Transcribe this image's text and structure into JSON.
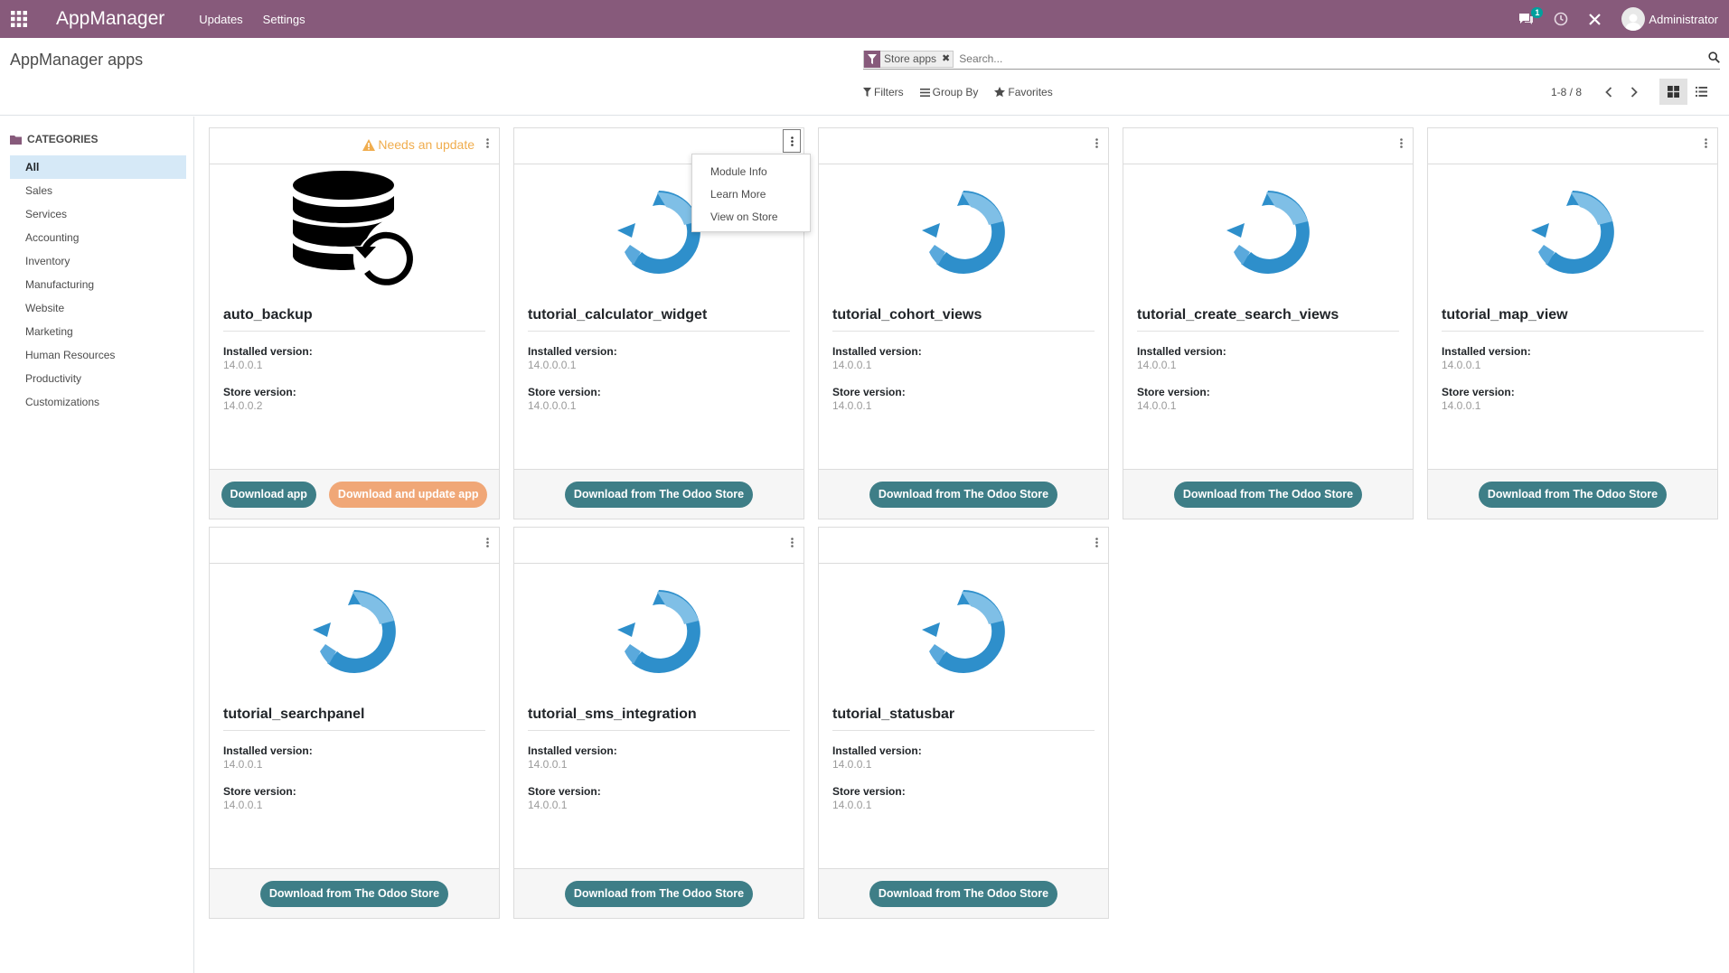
{
  "navbar": {
    "brand": "AppManager",
    "menu": [
      "Updates",
      "Settings"
    ],
    "messaging_badge": "1",
    "user": "Administrator"
  },
  "page": {
    "title": "AppManager apps"
  },
  "search": {
    "facet_label": "Store apps",
    "placeholder": "Search..."
  },
  "options": {
    "filters": "Filters",
    "group_by": "Group By",
    "favorites": "Favorites"
  },
  "pager": {
    "value": "1-8 / 8"
  },
  "sidebar": {
    "header": "CATEGORIES",
    "items": [
      "All",
      "Sales",
      "Services",
      "Accounting",
      "Inventory",
      "Manufacturing",
      "Website",
      "Marketing",
      "Human Resources",
      "Productivity",
      "Customizations"
    ],
    "active": "All"
  },
  "labels": {
    "installed_version": "Installed version:",
    "store_version": "Store version:",
    "needs_update": "Needs an update",
    "download_store": "Download from The Odoo Store",
    "download_app": "Download app",
    "download_update": "Download and update app"
  },
  "dropdown": {
    "items": [
      "Module Info",
      "Learn More",
      "View on Store"
    ]
  },
  "apps": [
    {
      "name": "auto_backup",
      "installed": "14.0.0.1",
      "store": "14.0.0.2",
      "needs_update": true,
      "icon": "database-restore-icon"
    },
    {
      "name": "tutorial_calculator_widget",
      "installed": "14.0.0.0.1",
      "store": "14.0.0.0.1",
      "needs_update": false,
      "icon": "odoo-logo-icon"
    },
    {
      "name": "tutorial_cohort_views",
      "installed": "14.0.0.1",
      "store": "14.0.0.1",
      "needs_update": false,
      "icon": "odoo-logo-icon"
    },
    {
      "name": "tutorial_create_search_views",
      "installed": "14.0.0.1",
      "store": "14.0.0.1",
      "needs_update": false,
      "icon": "odoo-logo-icon"
    },
    {
      "name": "tutorial_map_view",
      "installed": "14.0.0.1",
      "store": "14.0.0.1",
      "needs_update": false,
      "icon": "odoo-logo-icon"
    },
    {
      "name": "tutorial_searchpanel",
      "installed": "14.0.0.1",
      "store": "14.0.0.1",
      "needs_update": false,
      "icon": "odoo-logo-icon"
    },
    {
      "name": "tutorial_sms_integration",
      "installed": "14.0.0.1",
      "store": "14.0.0.1",
      "needs_update": false,
      "icon": "odoo-logo-icon"
    },
    {
      "name": "tutorial_statusbar",
      "installed": "14.0.0.1",
      "store": "14.0.0.1",
      "needs_update": false,
      "icon": "odoo-logo-icon"
    }
  ],
  "colors": {
    "brand": "#875A7B",
    "primary_button": "#3E7E87",
    "warning_button": "#F0A777",
    "warning_text": "#F0AD4E",
    "active_category": "#d6e9f7",
    "logo_blue": "#2E8FCB"
  }
}
